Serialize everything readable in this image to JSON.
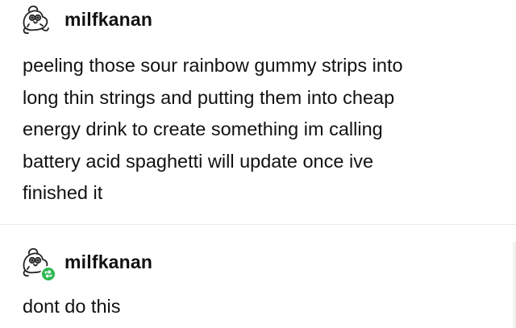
{
  "posts": [
    {
      "username": "milfkanan",
      "avatar_icon": "pigeon-doodle-icon",
      "lines": [
        "peeling those sour rainbow gummy strips into",
        "long thin strings and putting them into cheap",
        "energy drink to create something im calling",
        "battery acid spaghetti will update once ive",
        "finished it"
      ]
    },
    {
      "username": "milfkanan",
      "avatar_icon": "pigeon-doodle-icon",
      "badge_icon": "reblog-icon",
      "badge_color": "#2db84f",
      "lines": [
        "dont do this"
      ]
    }
  ]
}
